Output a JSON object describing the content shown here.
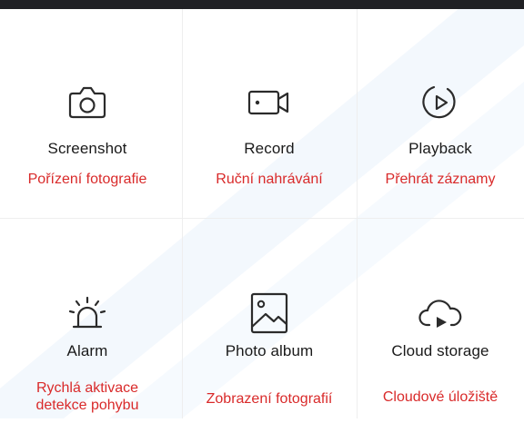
{
  "tiles": [
    {
      "title": "Screenshot",
      "subtitle": "Pořízení fotografie",
      "icon": "camera-icon"
    },
    {
      "title": "Record",
      "subtitle": "Ruční nahrávání",
      "icon": "video-camera-icon"
    },
    {
      "title": "Playback",
      "subtitle": "Přehrát záznamy",
      "icon": "playback-icon"
    },
    {
      "title": "Alarm",
      "subtitle_line1": "Rychlá aktivace",
      "subtitle_line2": "detekce pohybu",
      "icon": "alarm-siren-icon"
    },
    {
      "title": "Photo album",
      "subtitle": "Zobrazení fotografií",
      "icon": "photo-album-icon"
    },
    {
      "title": "Cloud storage",
      "subtitle": "Cloudové úložiště",
      "icon": "cloud-play-icon"
    }
  ],
  "colors": {
    "accent": "#d92a2a",
    "text": "#1a1a1a",
    "icon": "#2b2b2b",
    "topbar": "#1f2024",
    "watermark": "#cfe3f7"
  }
}
